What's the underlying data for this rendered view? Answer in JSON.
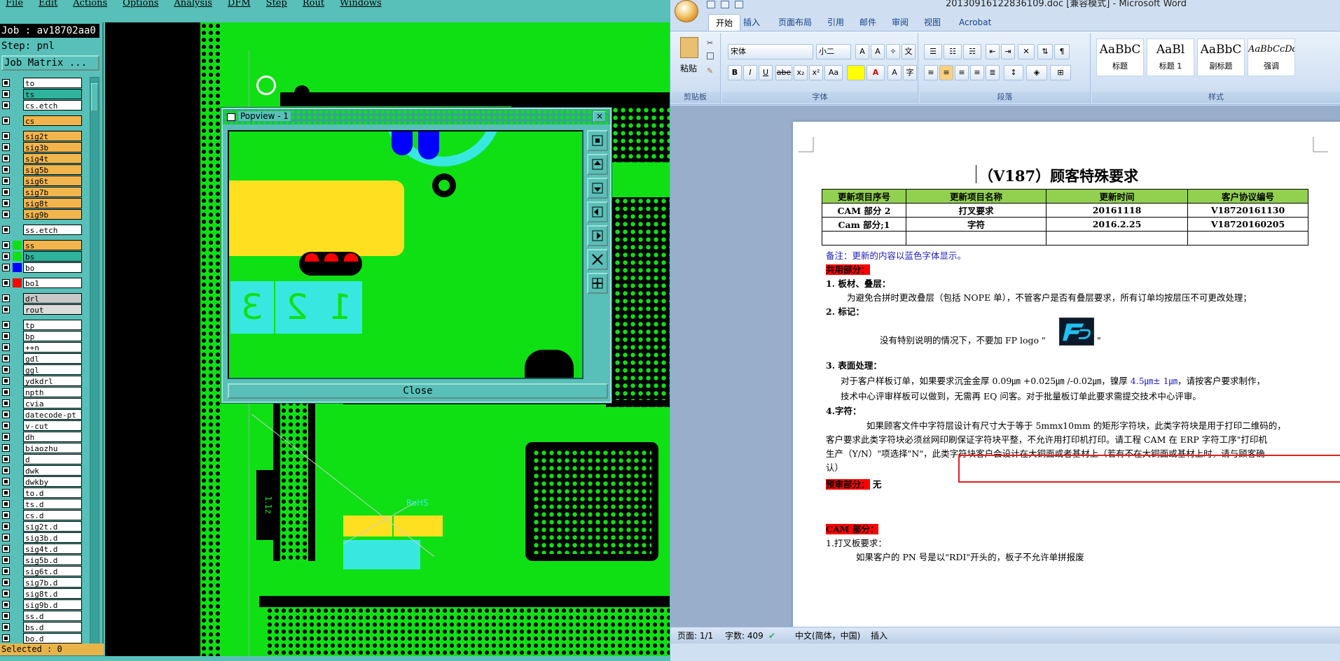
{
  "cam": {
    "menu": [
      "File",
      "Edit",
      "Actions",
      "Options",
      "Analysis",
      "DFM",
      "Step",
      "Rout",
      "Windows"
    ],
    "job_label": "Job : av18702aa0",
    "step_label": "Step: pnl",
    "job_matrix_label": "Job Matrix ...",
    "layers": [
      {
        "name": "to",
        "color": "#ffffff",
        "swatch": ""
      },
      {
        "name": "ts",
        "color": "#2fb39c",
        "swatch": ""
      },
      {
        "name": "cs.etch",
        "color": "#ffffff",
        "swatch": ""
      },
      {
        "name": "cs",
        "color": "#f2b44c",
        "swatch": ""
      },
      {
        "name": "sig2t",
        "color": "#f2b44c",
        "swatch": ""
      },
      {
        "name": "sig3b",
        "color": "#f2b44c",
        "swatch": ""
      },
      {
        "name": "sig4t",
        "color": "#f2b44c",
        "swatch": ""
      },
      {
        "name": "sig5b",
        "color": "#f2b44c",
        "swatch": ""
      },
      {
        "name": "sig6t",
        "color": "#f2b44c",
        "swatch": ""
      },
      {
        "name": "sig7b",
        "color": "#f2b44c",
        "swatch": ""
      },
      {
        "name": "sig8t",
        "color": "#f2b44c",
        "swatch": ""
      },
      {
        "name": "sig9b",
        "color": "#f2b44c",
        "swatch": ""
      },
      {
        "name": "ss.etch",
        "color": "#ffffff",
        "swatch": ""
      },
      {
        "name": "ss",
        "color": "#f2b44c",
        "swatch": "#0ee014"
      },
      {
        "name": "bs",
        "color": "#2fb39c",
        "swatch": "#0ee014"
      },
      {
        "name": "bo",
        "color": "#ffffff",
        "swatch": "#0000ff"
      },
      {
        "name": "bo1",
        "color": "#ffffff",
        "swatch": "#ff0000"
      },
      {
        "name": "drl",
        "color": "#c8c8c8",
        "swatch": ""
      },
      {
        "name": "rout",
        "color": "#dcdcdc",
        "swatch": ""
      },
      {
        "name": "tp",
        "color": "#ffffff",
        "swatch": ""
      },
      {
        "name": "bp",
        "color": "#ffffff",
        "swatch": ""
      },
      {
        "name": "++n",
        "color": "#ffffff",
        "swatch": ""
      },
      {
        "name": "gdl",
        "color": "#ffffff",
        "swatch": ""
      },
      {
        "name": "ggl",
        "color": "#ffffff",
        "swatch": ""
      },
      {
        "name": "ydkdrl",
        "color": "#ffffff",
        "swatch": ""
      },
      {
        "name": "npth",
        "color": "#ffffff",
        "swatch": ""
      },
      {
        "name": "cvia",
        "color": "#ffffff",
        "swatch": ""
      },
      {
        "name": "datecode-pt",
        "color": "#ffffff",
        "swatch": ""
      },
      {
        "name": "v-cut",
        "color": "#ffffff",
        "swatch": ""
      },
      {
        "name": "dh",
        "color": "#ffffff",
        "swatch": ""
      },
      {
        "name": "biaozhu",
        "color": "#ffffff",
        "swatch": ""
      },
      {
        "name": "d",
        "color": "#ffffff",
        "swatch": ""
      },
      {
        "name": "dwk",
        "color": "#ffffff",
        "swatch": ""
      },
      {
        "name": "dwkby",
        "color": "#ffffff",
        "swatch": ""
      },
      {
        "name": "to.d",
        "color": "#ffffff",
        "swatch": ""
      },
      {
        "name": "ts.d",
        "color": "#ffffff",
        "swatch": ""
      },
      {
        "name": "cs.d",
        "color": "#ffffff",
        "swatch": ""
      },
      {
        "name": "sig2t.d",
        "color": "#ffffff",
        "swatch": ""
      },
      {
        "name": "sig3b.d",
        "color": "#ffffff",
        "swatch": ""
      },
      {
        "name": "sig4t.d",
        "color": "#ffffff",
        "swatch": ""
      },
      {
        "name": "sig5b.d",
        "color": "#ffffff",
        "swatch": ""
      },
      {
        "name": "sig6t.d",
        "color": "#ffffff",
        "swatch": ""
      },
      {
        "name": "sig7b.d",
        "color": "#ffffff",
        "swatch": ""
      },
      {
        "name": "sig8t.d",
        "color": "#ffffff",
        "swatch": ""
      },
      {
        "name": "sig9b.d",
        "color": "#ffffff",
        "swatch": ""
      },
      {
        "name": "ss.d",
        "color": "#ffffff",
        "swatch": ""
      },
      {
        "name": "bs.d",
        "color": "#ffffff",
        "swatch": ""
      },
      {
        "name": "bo.d",
        "color": "#ffffff",
        "swatch": ""
      }
    ],
    "selected_label": "Selected : 0",
    "board_text": [
      "RoHS",
      "1.1z",
      "3",
      "2",
      "1"
    ],
    "popview": {
      "title": "Popview - 1",
      "close_x": "×",
      "close_label": "Close",
      "pad_numbers": [
        "3",
        "2",
        "1"
      ],
      "tools": [
        "zoom-fit-icon",
        "pan-up-icon",
        "pan-down-icon",
        "pan-left-icon",
        "pan-right-icon",
        "zoom-in-icon",
        "zoom-out-icon"
      ]
    }
  },
  "word": {
    "title": "20130916122836109.doc [兼容模式] - Microsoft Word",
    "tabs": [
      "开始",
      "插入",
      "页面布局",
      "引用",
      "邮件",
      "审阅",
      "视图",
      "Acrobat"
    ],
    "ribbon": {
      "paste_label": "粘贴",
      "clipboard_label": "剪贴板",
      "font_name": "宋体",
      "font_size": "小二",
      "font_group_label": "字体",
      "para_group_label": "段落",
      "styles_group_label": "样式",
      "styles": [
        {
          "preview": "AaBbC",
          "name": "标题"
        },
        {
          "preview": "AaBl",
          "name": "标题 1"
        },
        {
          "preview": "AaBbC",
          "name": "副标题"
        },
        {
          "preview": "AaBbCcDd",
          "name": "强调"
        }
      ],
      "font_buttons": [
        "B",
        "I",
        "U",
        "abe",
        "x₂",
        "x²",
        "Aa"
      ]
    },
    "doc": {
      "title": "（V187）顾客特殊要求",
      "table": {
        "headers": [
          "更新项目序号",
          "更新项目名称",
          "更新时间",
          "客户协议编号"
        ],
        "rows": [
          [
            "CAM 部分 2",
            "打叉要求",
            "20161118",
            "V18720161130"
          ],
          [
            "Cam 部分;1",
            "字符",
            "2016.2.25",
            "V18720160205"
          ],
          [
            "",
            "",
            "",
            ""
          ]
        ]
      },
      "note": "备注：更新的内容以蓝色字体显示。",
      "common_section": "共用部分：",
      "item1_title": "1.   板材、叠层：",
      "item1_text": "为避免合拼时更改叠层（包括 NOPE 单），不管客户是否有叠层要求，所有订单均按层压不可更改处理；",
      "item2_title": "2. 标记：",
      "item2_text": "没有特别说明的情况下，不要加 FP logo \"",
      "item2_end": "\"",
      "item3_title": "3. 表面处理：",
      "item3_text1a": "对于客户样板订单，如果要求沉金金厚 0.09㎛ +0.025㎛ /-0.02㎛，镍厚 ",
      "item3_text1b": "4.5㎛± 1㎛",
      "item3_text1c": "，请按客户要求制作，",
      "item3_text2": "技术中心评审样板可以做到，无需再 EQ 问客。对于批量板订单此要求需提交技术中心评审。",
      "item4_title": "4.字符：",
      "item4_line1": "如果顾客文件中字符层设计有尺寸大于等于 5mmx10mm 的矩形字符块，此类字符块是用于打印二维码的，",
      "item4_line2": "客户要求此类字符块必须丝网印刷保证字符块平整，不允许用打印机打印。请工程 CAM 在 ERP 字符工序\"打印机",
      "item4_line3a": "生产（Y/N）\"项选择\"N\"，",
      "item4_line3b": "此类字符块客户会设计在大铜面或者基材上（若有不在大铜面或基材上时，请与顾客确",
      "item4_line4": "认）",
      "pre_review": "预审部分：",
      "pre_review_value": "无",
      "cam_section": "CAM 部分：",
      "cam_item1": "1.打叉板要求：",
      "cam_item1_text": "如果客户的 PN 号是以\"RDI\"开头的，板子不允许单拼报废"
    },
    "status": {
      "page": "页面: 1/1",
      "words": "字数: 409",
      "lang": "中文(简体，中国)",
      "mode": "插入"
    }
  }
}
